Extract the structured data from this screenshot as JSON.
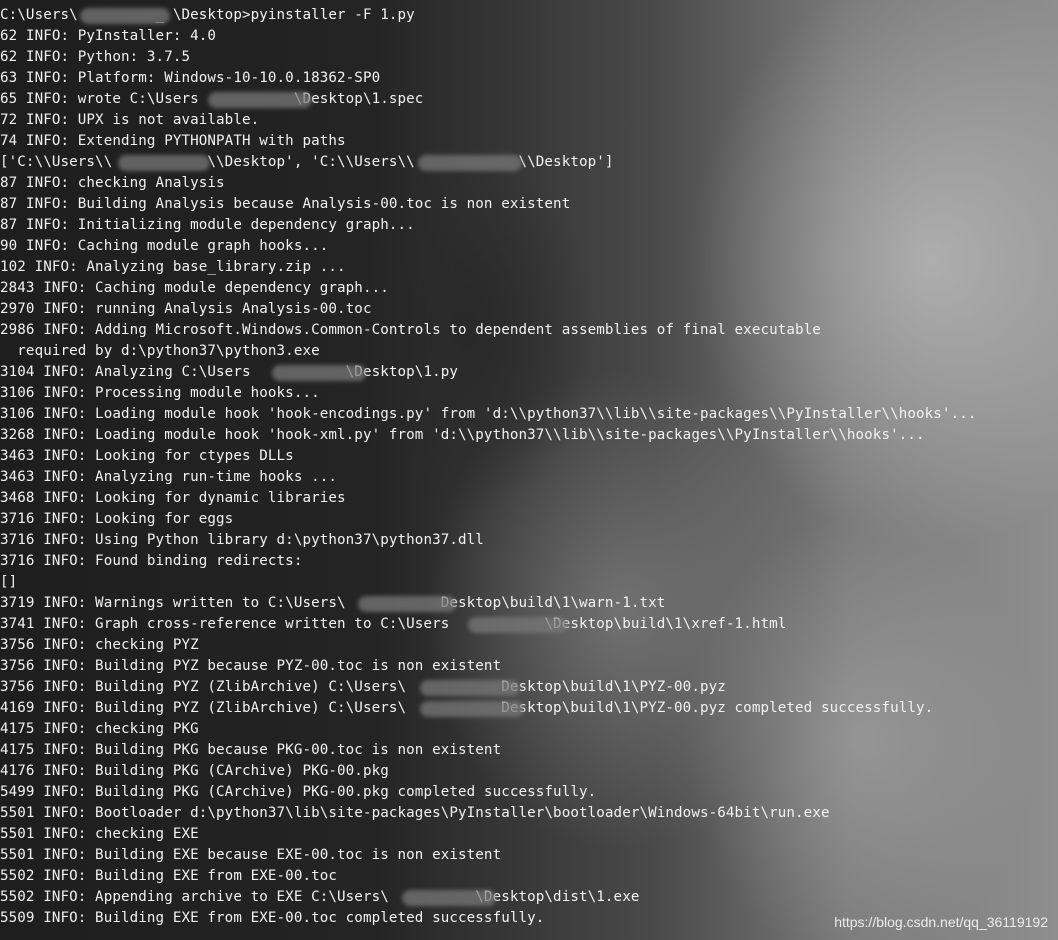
{
  "terminal": {
    "lines": [
      "C:\\Users\\         _ \\Desktop>pyinstaller -F 1.py",
      "62 INFO: PyInstaller: 4.0",
      "62 INFO: Python: 3.7.5",
      "63 INFO: Platform: Windows-10-10.0.18362-SP0",
      "65 INFO: wrote C:\\Users           \\Desktop\\1.spec",
      "72 INFO: UPX is not available.",
      "74 INFO: Extending PYTHONPATH with paths",
      "['C:\\\\Users\\\\           \\\\Desktop', 'C:\\\\Users\\\\            \\\\Desktop']",
      "87 INFO: checking Analysis",
      "87 INFO: Building Analysis because Analysis-00.toc is non existent",
      "87 INFO: Initializing module dependency graph...",
      "90 INFO: Caching module graph hooks...",
      "102 INFO: Analyzing base_library.zip ...",
      "2843 INFO: Caching module dependency graph...",
      "2970 INFO: running Analysis Analysis-00.toc",
      "2986 INFO: Adding Microsoft.Windows.Common-Controls to dependent assemblies of final executable",
      "  required by d:\\python37\\python3.exe",
      "3104 INFO: Analyzing C:\\Users           \\Desktop\\1.py",
      "3106 INFO: Processing module hooks...",
      "3106 INFO: Loading module hook 'hook-encodings.py' from 'd:\\\\python37\\\\lib\\\\site-packages\\\\PyInstaller\\\\hooks'...",
      "3268 INFO: Loading module hook 'hook-xml.py' from 'd:\\\\python37\\\\lib\\\\site-packages\\\\PyInstaller\\\\hooks'...",
      "3463 INFO: Looking for ctypes DLLs",
      "3463 INFO: Analyzing run-time hooks ...",
      "3468 INFO: Looking for dynamic libraries",
      "3716 INFO: Looking for eggs",
      "3716 INFO: Using Python library d:\\python37\\python37.dll",
      "3716 INFO: Found binding redirects:",
      "[]",
      "3719 INFO: Warnings written to C:\\Users\\           Desktop\\build\\1\\warn-1.txt",
      "3741 INFO: Graph cross-reference written to C:\\Users           \\Desktop\\build\\1\\xref-1.html",
      "3756 INFO: checking PYZ",
      "3756 INFO: Building PYZ because PYZ-00.toc is non existent",
      "3756 INFO: Building PYZ (ZlibArchive) C:\\Users\\           Desktop\\build\\1\\PYZ-00.pyz",
      "4169 INFO: Building PYZ (ZlibArchive) C:\\Users\\           Desktop\\build\\1\\PYZ-00.pyz completed successfully.",
      "4175 INFO: checking PKG",
      "4175 INFO: Building PKG because PKG-00.toc is non existent",
      "4176 INFO: Building PKG (CArchive) PKG-00.pkg",
      "5499 INFO: Building PKG (CArchive) PKG-00.pkg completed successfully.",
      "5501 INFO: Bootloader d:\\python37\\lib\\site-packages\\PyInstaller\\bootloader\\Windows-64bit\\run.exe",
      "5501 INFO: checking EXE",
      "5501 INFO: Building EXE because EXE-00.toc is non existent",
      "5502 INFO: Building EXE from EXE-00.toc",
      "5502 INFO: Appending archive to EXE C:\\Users\\          \\Desktop\\dist\\1.exe",
      "5509 INFO: Building EXE from EXE-00.toc completed successfully."
    ]
  },
  "watermark": {
    "text": "https://blog.csdn.net/qq_36119192"
  }
}
